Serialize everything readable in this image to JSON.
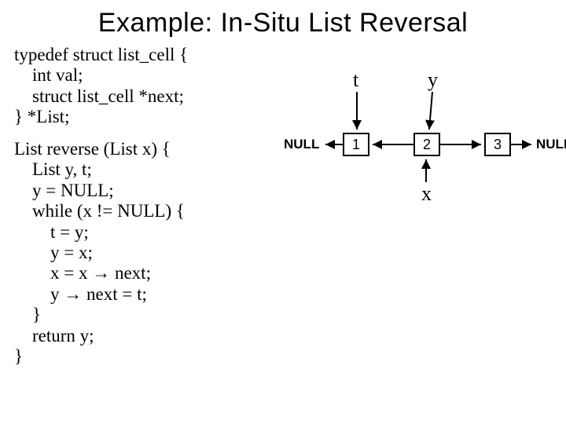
{
  "title": "Example: In-Situ List Reversal",
  "code": {
    "typedef": "typedef struct list_cell {\n    int val;\n    struct list_cell *next;\n} *List;",
    "reverse": "List reverse (List x) {\n    List y, t;\n    y = NULL;\n    while (x != NULL) {\n        t = y;\n        y = x;\n        x = x → next;\n        y → next = t;\n    }\n    return y;\n}"
  },
  "diagram": {
    "t_label": "t",
    "y_label": "y",
    "x_label": "x",
    "null_left": "NULL",
    "null_right": "NULL",
    "node1": "1",
    "node2": "2",
    "node3": "3"
  }
}
